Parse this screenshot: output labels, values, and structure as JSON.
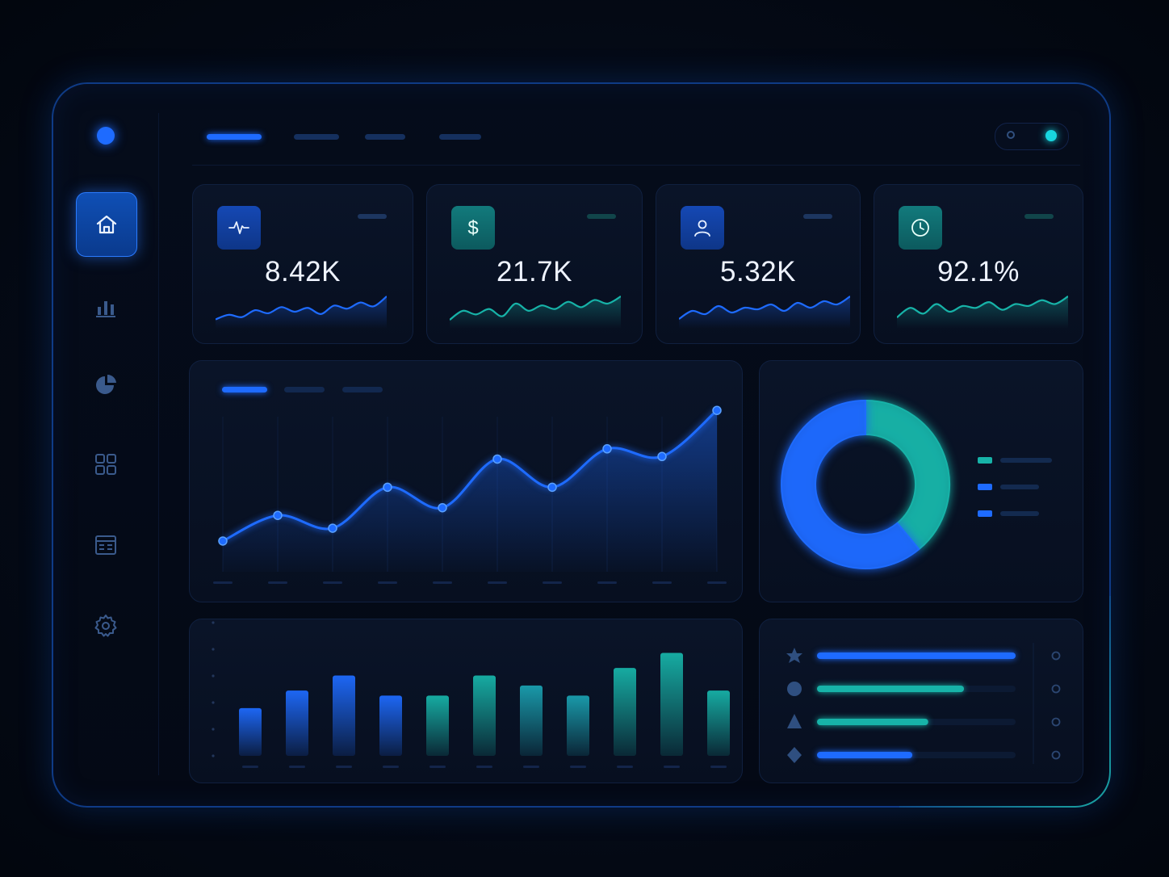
{
  "kpis": [
    {
      "value": "8.42K",
      "icon": "activity-icon",
      "color": "#1e6bff",
      "spark": [
        10,
        16,
        13,
        22,
        18,
        26,
        20,
        25,
        17,
        28,
        24,
        32,
        27,
        40
      ]
    },
    {
      "value": "21.7K",
      "icon": "dollar-icon",
      "color": "#17b3a8",
      "spark": [
        8,
        18,
        14,
        20,
        12,
        26,
        18,
        24,
        20,
        28,
        22,
        30,
        26,
        34
      ]
    },
    {
      "value": "5.32K",
      "icon": "user-icon",
      "color": "#1e6bff",
      "spark": [
        10,
        20,
        16,
        26,
        18,
        24,
        22,
        28,
        20,
        30,
        24,
        32,
        28,
        38
      ]
    },
    {
      "value": "92.1%",
      "icon": "clock-icon",
      "color": "#17b3a8",
      "spark": [
        10,
        20,
        14,
        24,
        16,
        22,
        20,
        26,
        18,
        24,
        22,
        28,
        24,
        32
      ]
    }
  ],
  "sidebar": {
    "items": [
      {
        "icon": "home-icon",
        "active": true
      },
      {
        "icon": "bar-chart-icon",
        "active": false
      },
      {
        "icon": "pie-chart-icon",
        "active": false
      },
      {
        "icon": "grid-icon",
        "active": false
      },
      {
        "icon": "table-icon",
        "active": false
      },
      {
        "icon": "settings-icon",
        "active": false
      }
    ]
  },
  "colors": {
    "accent": "#1e6bff",
    "teal": "#17b3a8",
    "background": "#040a16"
  },
  "chart_data": [
    {
      "type": "line",
      "x": [
        1,
        2,
        3,
        4,
        5,
        6,
        7,
        8,
        9,
        10
      ],
      "series": [
        {
          "values": [
            12,
            22,
            17,
            33,
            25,
            44,
            33,
            48,
            45,
            63
          ]
        }
      ],
      "ylim": [
        0,
        70
      ],
      "grid": true
    },
    {
      "type": "pie",
      "values": [
        39,
        61
      ],
      "colors": [
        "#17b3a8",
        "#1e6bff"
      ],
      "legend": "right"
    },
    {
      "type": "bar",
      "values": [
        19,
        26,
        32,
        24,
        24,
        32,
        28,
        24,
        35,
        41,
        26
      ],
      "colors": [
        "#1e6bff",
        "#1e6bff",
        "#1e6bff",
        "#1e6bff",
        "#17b3a8",
        "#17b3a8",
        "#1aa0b0",
        "#1aa0b0",
        "#17b3a8",
        "#17b3a8",
        "#17b3a8"
      ],
      "ylim": [
        0,
        45
      ]
    },
    {
      "type": "bar",
      "categories": [
        "star-icon",
        "circle-icon",
        "triangle-icon",
        "diamond-icon"
      ],
      "values": [
        100,
        74,
        56,
        48
      ],
      "colors": [
        "#1e6bff",
        "#17b3a8",
        "#17b3a8",
        "#1e6bff"
      ],
      "ylim": [
        0,
        100
      ]
    }
  ]
}
